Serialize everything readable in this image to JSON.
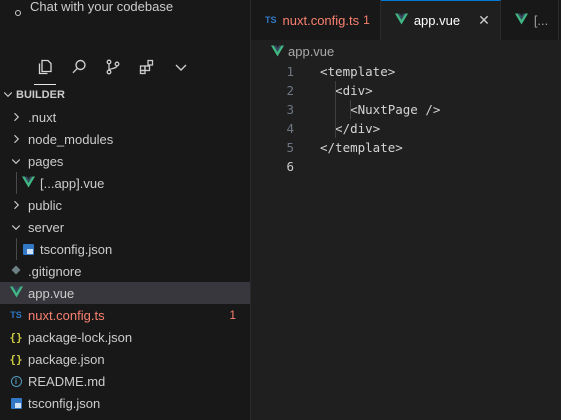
{
  "sidebar": {
    "chat_label": "Chat with your codebase",
    "activity_icons": [
      "files-icon",
      "search-icon",
      "source-control-icon",
      "extensions-icon",
      "chevron-down-icon"
    ],
    "section_title": "BUILDER",
    "tree": [
      {
        "label": ".nuxt",
        "type": "folder",
        "expanded": false,
        "depth": 0
      },
      {
        "label": "node_modules",
        "type": "folder",
        "expanded": false,
        "depth": 0
      },
      {
        "label": "pages",
        "type": "folder",
        "expanded": true,
        "depth": 0
      },
      {
        "label": "[...app].vue",
        "type": "vue",
        "depth": 1
      },
      {
        "label": "public",
        "type": "folder",
        "expanded": false,
        "depth": 0
      },
      {
        "label": "server",
        "type": "folder",
        "expanded": true,
        "depth": 0
      },
      {
        "label": "tsconfig.json",
        "type": "tsconfig",
        "depth": 1
      },
      {
        "label": ".gitignore",
        "type": "git",
        "depth": 0
      },
      {
        "label": "app.vue",
        "type": "vue",
        "depth": 0,
        "selected": true
      },
      {
        "label": "nuxt.config.ts",
        "type": "ts",
        "depth": 0,
        "badge": "1",
        "error": true
      },
      {
        "label": "package-lock.json",
        "type": "json",
        "depth": 0
      },
      {
        "label": "package.json",
        "type": "json",
        "depth": 0
      },
      {
        "label": "README.md",
        "type": "info",
        "depth": 0
      },
      {
        "label": "tsconfig.json",
        "type": "tsconfig",
        "depth": 0
      }
    ]
  },
  "editor": {
    "tabs": [
      {
        "label": "nuxt.config.ts",
        "type": "ts",
        "count": "1",
        "error": true,
        "active": false
      },
      {
        "label": "app.vue",
        "type": "vue",
        "active": true,
        "closable": true
      },
      {
        "label": "[...",
        "type": "vue",
        "active": false
      }
    ],
    "breadcrumb": "app.vue",
    "lines": [
      {
        "n": "1",
        "text": "<template>"
      },
      {
        "n": "2",
        "text": "  <div>"
      },
      {
        "n": "3",
        "text": "    <NuxtPage />"
      },
      {
        "n": "4",
        "text": "  </div>"
      },
      {
        "n": "5",
        "text": "</template>"
      },
      {
        "n": "6",
        "text": "",
        "current": true
      }
    ]
  },
  "colors": {
    "vue": "#41b883",
    "ts": "#3178c6",
    "json": "#cbcb41",
    "error": "#f88070",
    "accent": "#0078d4",
    "selection": "#37373d"
  }
}
